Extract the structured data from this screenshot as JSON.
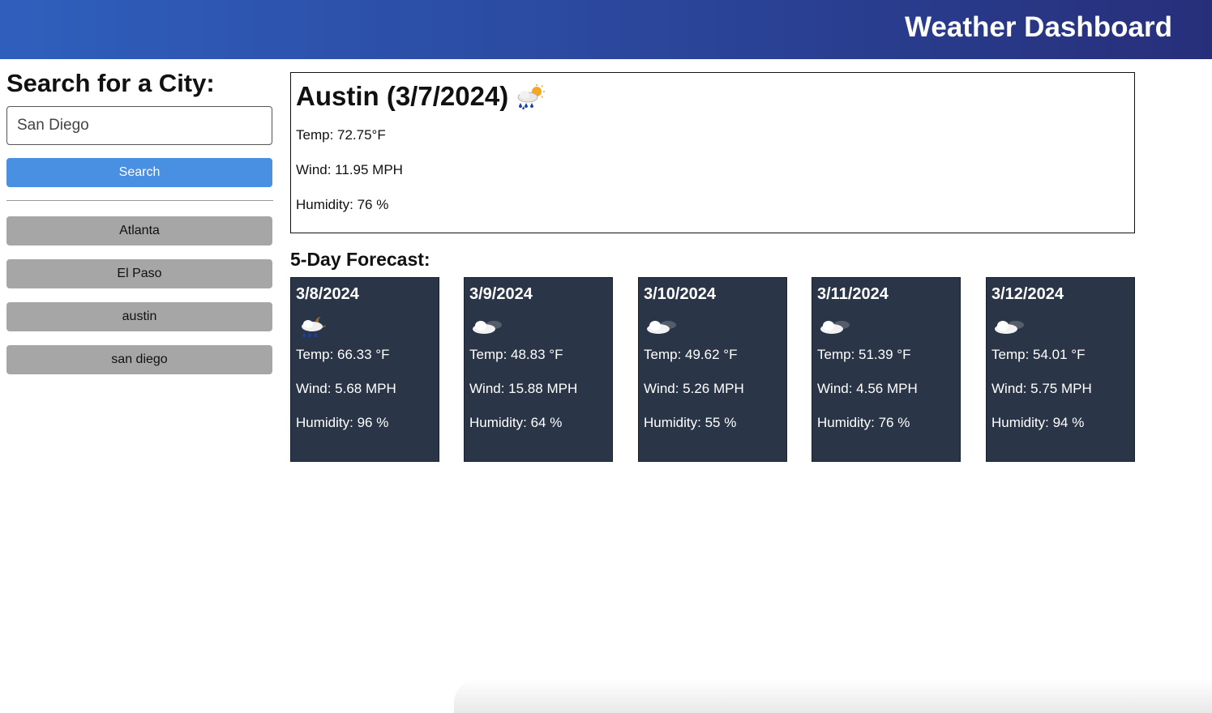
{
  "header": {
    "title": "Weather Dashboard"
  },
  "sidebar": {
    "heading": "Search for a City:",
    "search_value": "San Diego",
    "search_button": "Search",
    "history": [
      "Atlanta",
      "El Paso",
      "austin",
      "san diego"
    ]
  },
  "current": {
    "title": "Austin (3/7/2024)",
    "icon": "rain-cloud-sun-icon",
    "temp": "Temp: 72.75°F",
    "wind": "Wind: 11.95 MPH",
    "humidity": "Humidity: 76 %"
  },
  "forecast": {
    "title": "5-Day Forecast:",
    "days": [
      {
        "date": "3/8/2024",
        "icon": "rain-cloud-moon-icon",
        "temp": "Temp: 66.33 °F",
        "wind": "Wind: 5.68 MPH",
        "humidity": "Humidity: 96 %"
      },
      {
        "date": "3/9/2024",
        "icon": "cloud-moon-icon",
        "temp": "Temp: 48.83 °F",
        "wind": "Wind: 15.88 MPH",
        "humidity": "Humidity: 64 %"
      },
      {
        "date": "3/10/2024",
        "icon": "cloud-moon-icon",
        "temp": "Temp: 49.62 °F",
        "wind": "Wind: 5.26 MPH",
        "humidity": "Humidity: 55 %"
      },
      {
        "date": "3/11/2024",
        "icon": "cloud-moon-icon",
        "temp": "Temp: 51.39 °F",
        "wind": "Wind: 4.56 MPH",
        "humidity": "Humidity: 76 %"
      },
      {
        "date": "3/12/2024",
        "icon": "cloud-moon-icon",
        "temp": "Temp: 54.01 °F",
        "wind": "Wind: 5.75 MPH",
        "humidity": "Humidity: 94 %"
      }
    ]
  },
  "colors": {
    "header_gradient_start": "#2f5fbd",
    "header_gradient_end": "#272f7a",
    "search_button": "#4a90e2",
    "history_button": "#a6a6a6",
    "forecast_card": "#2a3547"
  }
}
